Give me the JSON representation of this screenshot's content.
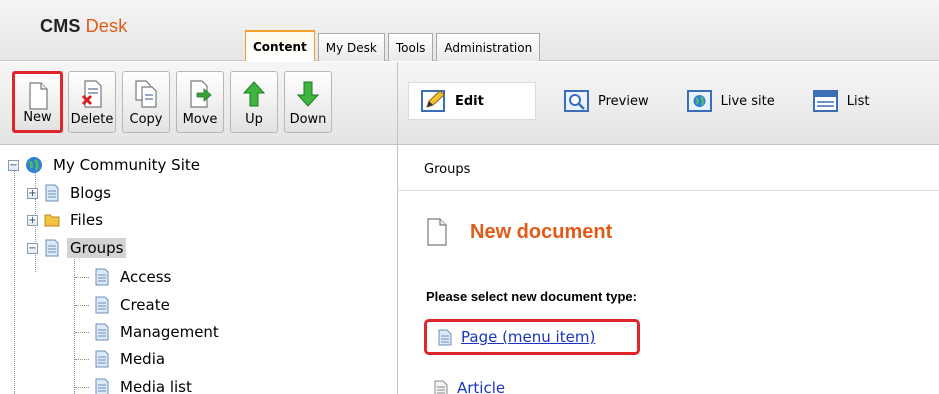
{
  "app": {
    "logo_cms": "CMS",
    "logo_desk": "Desk"
  },
  "tabs": [
    {
      "label": "Content",
      "active": true
    },
    {
      "label": "My Desk"
    },
    {
      "label": "Tools"
    },
    {
      "label": "Administration"
    }
  ],
  "toolbar": {
    "new": "New",
    "delete": "Delete",
    "copy": "Copy",
    "move": "Move",
    "up": "Up",
    "down": "Down"
  },
  "views": {
    "edit": "Edit",
    "preview": "Preview",
    "live_site": "Live site",
    "list": "List"
  },
  "tree": {
    "root": "My Community Site",
    "blogs": "Blogs",
    "files": "Files",
    "groups": "Groups",
    "children": [
      "Access",
      "Create",
      "Management",
      "Media",
      "Media list"
    ]
  },
  "content": {
    "breadcrumb": "Groups",
    "title": "New document",
    "prompt": "Please select new document type:",
    "types": [
      "Page (menu item)",
      "Article"
    ]
  },
  "colors": {
    "accent": "#e25a15",
    "highlight": "#e0262b",
    "link": "#1a35c0"
  }
}
